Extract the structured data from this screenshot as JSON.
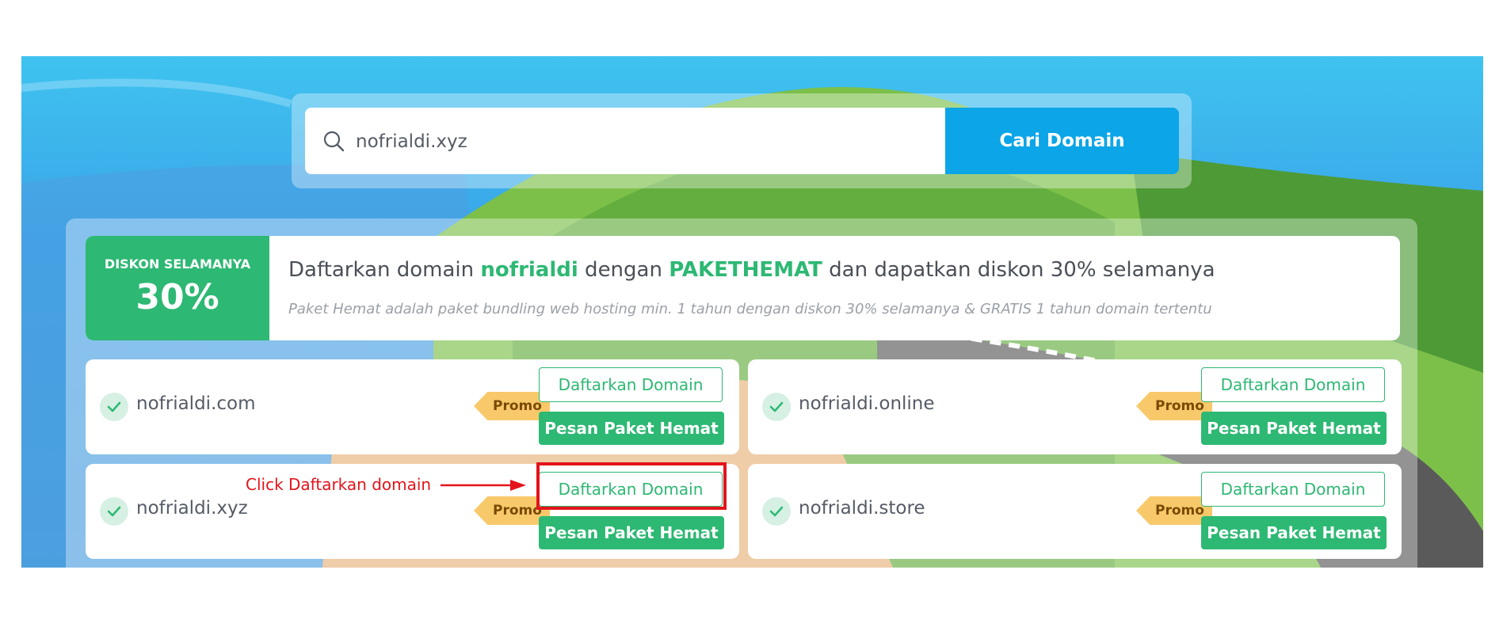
{
  "search": {
    "value": "nofrialdi.xyz",
    "button_label": "Cari Domain"
  },
  "banner": {
    "discount_label": "DISKON SELAMANYA",
    "discount_value": "30%",
    "title_prefix": "Daftarkan domain ",
    "title_domain": "nofrialdi",
    "title_middle": " dengan ",
    "title_package": "PAKETHEMAT",
    "title_suffix": " dan dapatkan diskon 30% selamanya",
    "subtitle": "Paket Hemat adalah paket bundling web hosting min. 1 tahun dengan diskon 30% selamanya & GRATIS 1 tahun domain tertentu"
  },
  "results": [
    {
      "domain": "nofrialdi.com",
      "tag": "Promo",
      "register_label": "Daftarkan Domain",
      "package_label": "Pesan Paket Hemat"
    },
    {
      "domain": "nofrialdi.online",
      "tag": "Promo",
      "register_label": "Daftarkan Domain",
      "package_label": "Pesan Paket Hemat"
    },
    {
      "domain": "nofrialdi.xyz",
      "tag": "Promo",
      "register_label": "Daftarkan Domain",
      "package_label": "Pesan Paket Hemat"
    },
    {
      "domain": "nofrialdi.store",
      "tag": "Promo",
      "register_label": "Daftarkan Domain",
      "package_label": "Pesan Paket Hemat"
    }
  ],
  "annotation": {
    "text": "Click Daftarkan domain"
  },
  "colors": {
    "brand_green": "#2db873",
    "search_blue": "#0ca5e7",
    "promo_yellow": "#f8c96b",
    "annotation_red": "#e3141b"
  }
}
